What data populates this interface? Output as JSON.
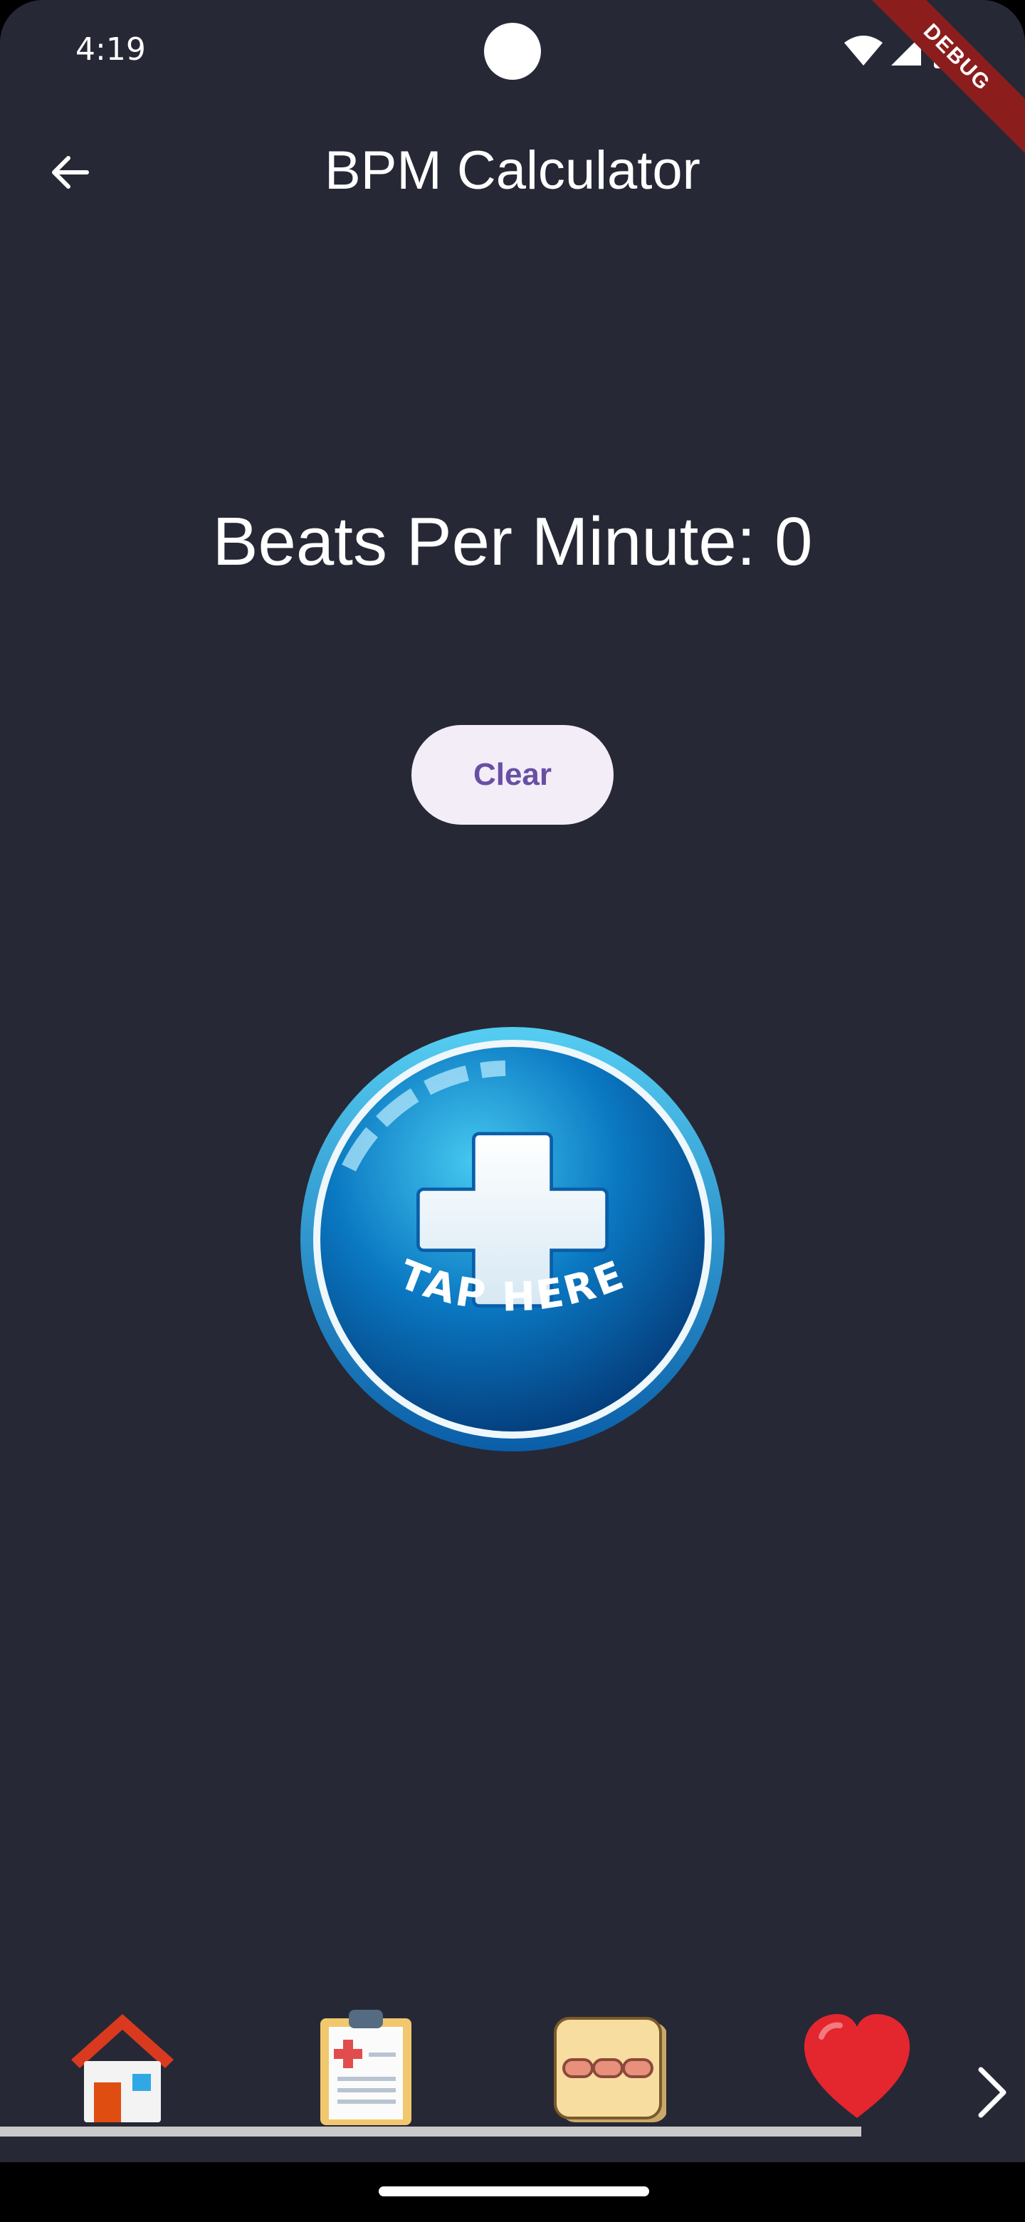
{
  "status_bar": {
    "time": "4:19",
    "debug_label": "DEBUG"
  },
  "app_bar": {
    "title": "BPM Calculator"
  },
  "main": {
    "bpm_text": "Beats Per Minute: 0",
    "clear_label": "Clear",
    "tap_label": "TAP HERE"
  },
  "bottom_nav": {
    "items": [
      {
        "icon": "home-icon"
      },
      {
        "icon": "clipboard-medical-icon"
      },
      {
        "icon": "capsules-icon"
      },
      {
        "icon": "heart-icon"
      }
    ],
    "next_icon": "chevron-right-icon"
  },
  "colors": {
    "background": "#262835",
    "clear_button_bg": "#f3edf7",
    "clear_button_text": "#6750a4",
    "debug_ribbon": "#8c1d1d",
    "tap_button_blue": "#0a78c2"
  }
}
